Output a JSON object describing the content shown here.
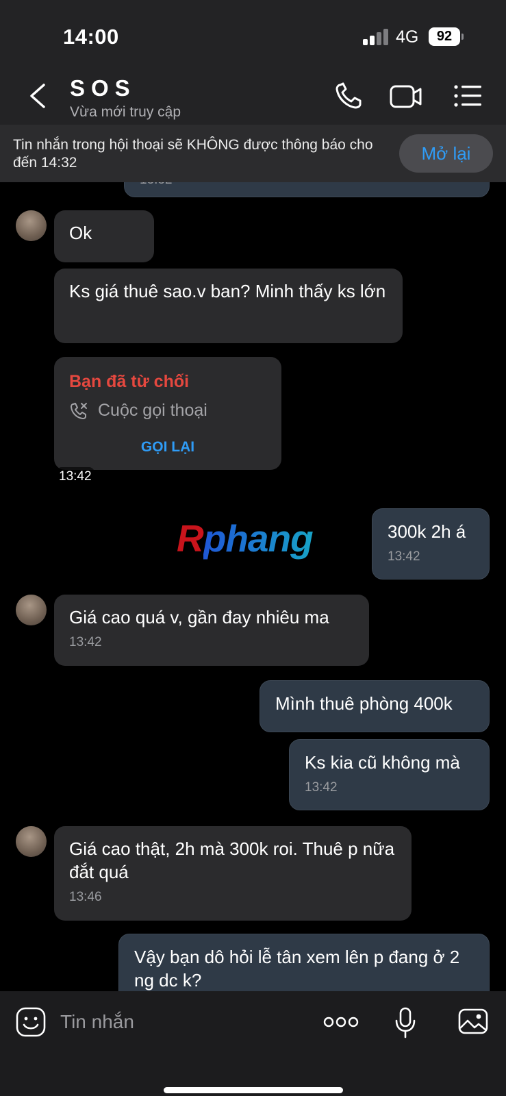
{
  "status": {
    "time": "14:00",
    "network": "4G",
    "battery": "92"
  },
  "header": {
    "title": "SOS",
    "subtitle": "Vừa mới truy cập"
  },
  "notice": {
    "text": "Tin nhắn trong hội thoại sẽ KHÔNG được thông báo cho đến 14:32",
    "button": "Mở lại"
  },
  "messages": [
    {
      "text": "13:32"
    },
    {
      "text": "Ok"
    },
    {
      "text": "Ks giá thuê sao.v ban? Minh thấy ks lớn"
    },
    {
      "text": "300k 2h á",
      "time": "13:42"
    },
    {
      "text": "Giá cao quá v, gần đay nhiêu ma",
      "time": "13:42"
    },
    {
      "text": "Mình thuê phòng 400k"
    },
    {
      "text": "Ks kia cũ không mà",
      "time": "13:42"
    },
    {
      "text": "Giá cao thật, 2h mà 300k roi. Thuê p nữa đắt quá",
      "time": "13:46"
    },
    {
      "text": "Vậy bạn dô hỏi lễ tân xem lên p đang ở 2 ng dc k?"
    }
  ],
  "call": {
    "status": "Bạn đã từ chối",
    "type": "Cuộc gọi thoại",
    "action": "GỌI LẠI",
    "time": "13:42"
  },
  "watermark": {
    "first": "R",
    "rest": "phang"
  },
  "composer": {
    "placeholder": "Tin nhắn"
  },
  "colors": {
    "accent": "#2f9cf6",
    "declined": "#e5483f",
    "outgoing_bubble": "#2f3a47",
    "incoming_bubble": "#2b2b2d"
  }
}
